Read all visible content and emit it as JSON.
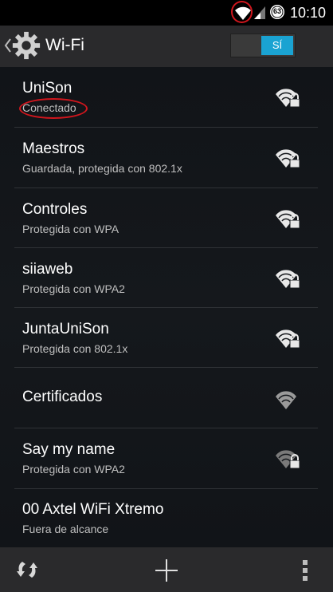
{
  "status_bar": {
    "time": "10:10",
    "battery": "63",
    "icons": [
      "wifi-icon",
      "signal-icon",
      "battery-icon"
    ]
  },
  "action_bar": {
    "title": "Wi-Fi",
    "toggle_label": "SÍ",
    "toggle_color": "#1aa3d2"
  },
  "networks": [
    {
      "name": "UniSon",
      "status": "Conectado",
      "icon": "wifi-lock-icon"
    },
    {
      "name": "Maestros",
      "status": "Guardada, protegida con 802.1x",
      "icon": "wifi-lock-icon"
    },
    {
      "name": "Controles",
      "status": "Protegida con WPA",
      "icon": "wifi-lock-icon"
    },
    {
      "name": "siiaweb",
      "status": "Protegida con WPA2",
      "icon": "wifi-lock-icon"
    },
    {
      "name": "JuntaUniSon",
      "status": "Protegida con 802.1x",
      "icon": "wifi-lock-icon"
    },
    {
      "name": "Certificados",
      "status": "",
      "icon": "wifi-icon"
    },
    {
      "name": "Say my name",
      "status": "Protegida con WPA2",
      "icon": "wifi-lock-icon"
    },
    {
      "name": "00 Axtel WiFi Xtremo",
      "status": "Fuera de alcance",
      "icon": ""
    }
  ],
  "bottom_bar": {
    "icons": [
      "refresh-icon",
      "add-icon",
      "overflow-menu-icon"
    ]
  },
  "colors": {
    "accent": "#1aa3d2",
    "annotation": "#d0161d"
  }
}
